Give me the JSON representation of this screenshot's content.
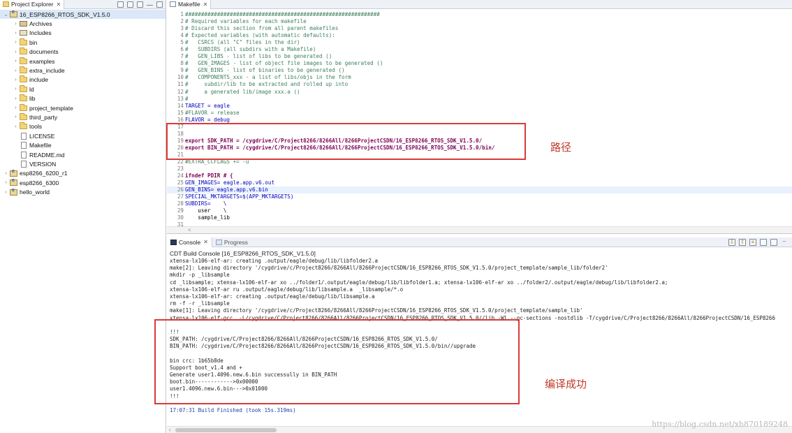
{
  "left_panel": {
    "tab_title": "Project Explorer",
    "tree": [
      {
        "label": "16_ESP8266_RTOS_SDK_V1.5.0",
        "arrow": "⌄",
        "icon": "proj",
        "indent": 0,
        "selected": true
      },
      {
        "label": "Archives",
        "arrow": "›",
        "icon": "lib",
        "indent": 1
      },
      {
        "label": "Includes",
        "arrow": "›",
        "icon": "inc",
        "indent": 1
      },
      {
        "label": "bin",
        "arrow": "›",
        "icon": "folder",
        "indent": 1
      },
      {
        "label": "documents",
        "arrow": "›",
        "icon": "folder",
        "indent": 1
      },
      {
        "label": "examples",
        "arrow": "›",
        "icon": "folder",
        "indent": 1
      },
      {
        "label": "extra_include",
        "arrow": "›",
        "icon": "folder",
        "indent": 1
      },
      {
        "label": "include",
        "arrow": "›",
        "icon": "folder",
        "indent": 1
      },
      {
        "label": "ld",
        "arrow": "›",
        "icon": "folder",
        "indent": 1
      },
      {
        "label": "lib",
        "arrow": "›",
        "icon": "folder",
        "indent": 1
      },
      {
        "label": "project_template",
        "arrow": "›",
        "icon": "folder",
        "indent": 1
      },
      {
        "label": "third_party",
        "arrow": "›",
        "icon": "folder",
        "indent": 1
      },
      {
        "label": "tools",
        "arrow": "›",
        "icon": "folder",
        "indent": 1
      },
      {
        "label": "LICENSE",
        "arrow": "",
        "icon": "file",
        "indent": 1
      },
      {
        "label": "Makefile",
        "arrow": "",
        "icon": "file",
        "indent": 1
      },
      {
        "label": "README.md",
        "arrow": "",
        "icon": "file",
        "indent": 1
      },
      {
        "label": "VERSION",
        "arrow": "",
        "icon": "file",
        "indent": 1
      },
      {
        "label": "esp8266_6200_r1",
        "arrow": "›",
        "icon": "proj",
        "indent": 0
      },
      {
        "label": "esp8266_6300",
        "arrow": "›",
        "icon": "proj",
        "indent": 0
      },
      {
        "label": "hello_world",
        "arrow": "›",
        "icon": "proj",
        "indent": 0
      }
    ]
  },
  "editor": {
    "tab_title": "Makefile",
    "lines": [
      {
        "n": "1",
        "t": "#############################################################",
        "k": "com"
      },
      {
        "n": "2",
        "t": "# Required variables for each makefile",
        "k": "com"
      },
      {
        "n": "3",
        "t": "# Discard this section from all parent makefiles",
        "k": "com"
      },
      {
        "n": "4",
        "t": "# Expected variables (with automatic defaults):",
        "k": "com"
      },
      {
        "n": "5",
        "t": "#   CSRCS (all \"C\" files in the dir)",
        "k": "com"
      },
      {
        "n": "6",
        "t": "#   SUBDIRS (all subdirs with a Makefile)",
        "k": "com"
      },
      {
        "n": "7",
        "t": "#   GEN_LIBS - list of libs to be generated ()",
        "k": "com"
      },
      {
        "n": "8",
        "t": "#   GEN_IMAGES - list of object file images to be generated ()",
        "k": "com"
      },
      {
        "n": "9",
        "t": "#   GEN_BINS - list of binaries to be generated ()",
        "k": "com"
      },
      {
        "n": "10",
        "t": "#   COMPONENTS_xxx - a list of libs/objs in the form",
        "k": "com"
      },
      {
        "n": "11",
        "t": "#     subdir/lib to be extracted and rolled up into",
        "k": "com"
      },
      {
        "n": "12",
        "t": "#     a generated lib/image xxx.a ()",
        "k": "com"
      },
      {
        "n": "13",
        "t": "#",
        "k": "com"
      },
      {
        "n": "14",
        "t": "TARGET = eagle",
        "k": "var"
      },
      {
        "n": "15",
        "t": "#FLAVOR = release",
        "k": "com"
      },
      {
        "n": "16",
        "t": "FLAVOR = debug",
        "k": "var"
      },
      {
        "n": "17",
        "t": "",
        "k": ""
      },
      {
        "n": "18",
        "t": "",
        "k": ""
      },
      {
        "n": "19",
        "t": "export SDK_PATH = /cygdrive/C/Project8266/8266All/8266ProjectCSDN/16_ESP8266_RTOS_SDK_V1.5.0/",
        "k": "key"
      },
      {
        "n": "20",
        "t": "export BIN_PATH = /cygdrive/C/Project8266/8266All/8266ProjectCSDN/16_ESP8266_RTOS_SDK_V1.5.0/bin/",
        "k": "key"
      },
      {
        "n": "21",
        "t": "",
        "k": ""
      },
      {
        "n": "22",
        "t": "#EXTRA_CCFLAGS += -u",
        "k": "com"
      },
      {
        "n": "23",
        "t": "",
        "k": ""
      },
      {
        "n": "24",
        "t": "ifndef PDIR # {",
        "k": "key"
      },
      {
        "n": "25",
        "t": "GEN_IMAGES= eagle.app.v6.out",
        "k": "var"
      },
      {
        "n": "26",
        "t": "GEN_BINS= eagle.app.v6.bin",
        "k": "var",
        "hl": true
      },
      {
        "n": "27",
        "t": "SPECIAL_MKTARGETS=$(APP_MKTARGETS)",
        "k": "var"
      },
      {
        "n": "28",
        "t": "SUBDIRS=    \\",
        "k": "var"
      },
      {
        "n": "29",
        "t": "    user    \\",
        "k": ""
      },
      {
        "n": "30",
        "t": "    sample_lib",
        "k": ""
      },
      {
        "n": "31",
        "t": "",
        "k": ""
      }
    ],
    "hscroll_marker": "<"
  },
  "console": {
    "tab_label": "Console",
    "tab_progress": "Progress",
    "title": "CDT Build Console [16_ESP8266_RTOS_SDK_V1.5.0]",
    "lines": [
      "xtensa-lx106-elf-ar: creating .output/eagle/debug/lib/libfolder2.a",
      "make[2]: Leaving directory '/cygdrive/c/Project8266/8266All/8266ProjectCSDN/16_ESP8266_RTOS_SDK_V1.5.0/project_template/sample_lib/folder2'",
      "mkdir -p _libsample",
      "cd _libsample; xtensa-lx106-elf-ar xo ../folder1/.output/eagle/debug/lib/libfolder1.a; xtensa-lx106-elf-ar xo ../folder2/.output/eagle/debug/lib/libfolder2.a;",
      "xtensa-lx106-elf-ar ru .output/eagle/debug/lib/libsample.a  _libsample/*.o",
      "xtensa-lx106-elf-ar: creating .output/eagle/debug/lib/libsample.a",
      "rm -f -r _libsample",
      "make[1]: Leaving directory '/cygdrive/c/Project8266/8266All/8266ProjectCSDN/16_ESP8266_RTOS_SDK_V1.5.0/project_template/sample_lib'",
      "xtensa-lx106-elf-gcc  -L/cygdrive/C/Project8266/8266All/8266ProjectCSDN/16_ESP8266_RTOS_SDK_V1.5.0//lib -Wl,--gc-sections -nostdlib -T/cygdrive/C/Project8266/8266All/8266ProjectCSDN/16_ESP8266",
      "",
      "!!!",
      "SDK_PATH: /cygdrive/C/Project8266/8266All/8266ProjectCSDN/16_ESP8266_RTOS_SDK_V1.5.0/",
      "BIN_PATH: /cygdrive/C/Project8266/8266All/8266ProjectCSDN/16_ESP8266_RTOS_SDK_V1.5.0/bin//upgrade",
      "",
      "bin crc: 1b65b8de",
      "Support boot_v1.4 and +",
      "Generate user1.4096.new.6.bin successully in BIN_PATH",
      "boot.bin------------>0x00000",
      "user1.4096.new.6.bin--->0x01000",
      "!!!",
      "",
      "17:07:31 Build Finished (took 15s.319ms)"
    ],
    "build_line_index": 21
  },
  "annotations": {
    "path_label": "路径",
    "success_label": "编译成功",
    "color": "#d93a3a"
  },
  "watermark": "https://blog.csdn.net/xh870189248"
}
